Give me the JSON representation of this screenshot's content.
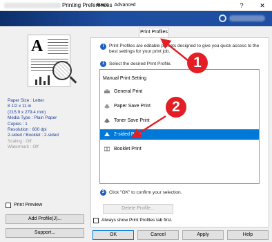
{
  "window": {
    "title": "Printing Preferences",
    "help_glyph": "?",
    "close_glyph": "✕"
  },
  "preview": {
    "letter": "A"
  },
  "settings": [
    {
      "label": "Paper Size : Letter"
    },
    {
      "label": "8 1/2 x 11 in"
    },
    {
      "label": "(215.9 x 279.4 mm)"
    },
    {
      "label": "Media Type : Plain Paper"
    },
    {
      "label": "Copies : 1"
    },
    {
      "label": "Resolution : 600 dpi"
    },
    {
      "label": "2-sided / Booklet : 2-sided"
    },
    {
      "label": "Scaling : Off"
    },
    {
      "label": "Watermark : Off"
    }
  ],
  "left_controls": {
    "print_preview_label": "Print Preview",
    "add_profile_label": "Add Profile(J)...",
    "support_label": "Support..."
  },
  "tabs": [
    {
      "label": "Basic"
    },
    {
      "label": "Advanced"
    },
    {
      "label": "Print Profiles"
    }
  ],
  "panel": {
    "intro_text_1": "Print Profiles are editable presets designed to give you quick access to the",
    "intro_text_2": "best settings for your print job.",
    "select_text": "Select the desired Print Profile.",
    "confirm_text": "Click \"OK\" to confirm your selection.",
    "delete_profile_label": "Delete Profile...",
    "always_show_label": "Always show Print Profiles tab first."
  },
  "profiles": {
    "header": "Manual Print Setting",
    "items": [
      {
        "label": "General Print",
        "icon": "printer-icon"
      },
      {
        "label": "Paper Save Print",
        "icon": "paper-save-icon"
      },
      {
        "label": "Toner Save Print",
        "icon": "toner-save-icon"
      },
      {
        "label": "2-sided Print",
        "icon": "duplex-icon"
      },
      {
        "label": "Booklet Print",
        "icon": "booklet-icon"
      }
    ]
  },
  "footer": {
    "ok_label": "OK",
    "cancel_label": "Cancel",
    "apply_label": "Apply",
    "help_label": "Help"
  },
  "annotations": [
    {
      "label": "1"
    },
    {
      "label": "2"
    }
  ],
  "colors": {
    "accent": "#0078d7",
    "annotation": "#e31e24",
    "settings_text": "#1a3f9a"
  }
}
